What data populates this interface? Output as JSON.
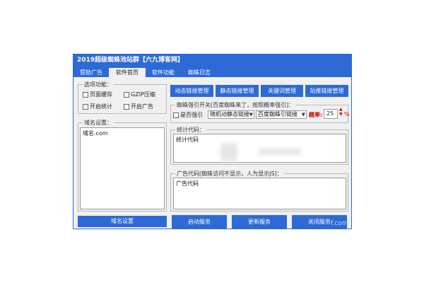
{
  "window": {
    "title": "2019超级蜘蛛池站群【六九博客网】"
  },
  "tabs": [
    {
      "label": "赞助广告"
    },
    {
      "label": "软件首页"
    },
    {
      "label": "软件功能"
    },
    {
      "label": "蜘蛛日志"
    }
  ],
  "options": {
    "label": "选项功能：",
    "page_cache": "页面缓存",
    "gzip": "GZIP压缩",
    "open_stats": "开启统计",
    "open_ads": "开启广告"
  },
  "domain": {
    "label": "域名设置：",
    "value": "域名.com",
    "button": "域名设置"
  },
  "top_buttons": [
    "动态链接管理",
    "静态链接管理",
    "关键词管理",
    "站推链接管理"
  ],
  "spider": {
    "label": "蜘蛛强引开关[百度蜘蛛来了，按照概率强引]：",
    "force_label": "是否强引",
    "select1": "随机动静态链接",
    "select2": "百度蜘蛛引链接",
    "prob_label": "概率:",
    "prob_value": "25",
    "prob_unit": "%"
  },
  "stats": {
    "label": "统计代码：",
    "value": "统计代码"
  },
  "ads": {
    "label": "广告代码[蜘蛛访问不显示，人为显示JS]：",
    "value": "广告代码"
  },
  "bottom_buttons": [
    "启动服务",
    "更新服务",
    "关闭服务"
  ],
  "watermark": {
    "text": "f.com"
  },
  "colors": {
    "accent": "#2d6ad6",
    "window_bg": "#f0f0f0",
    "probability": "#d00000"
  }
}
